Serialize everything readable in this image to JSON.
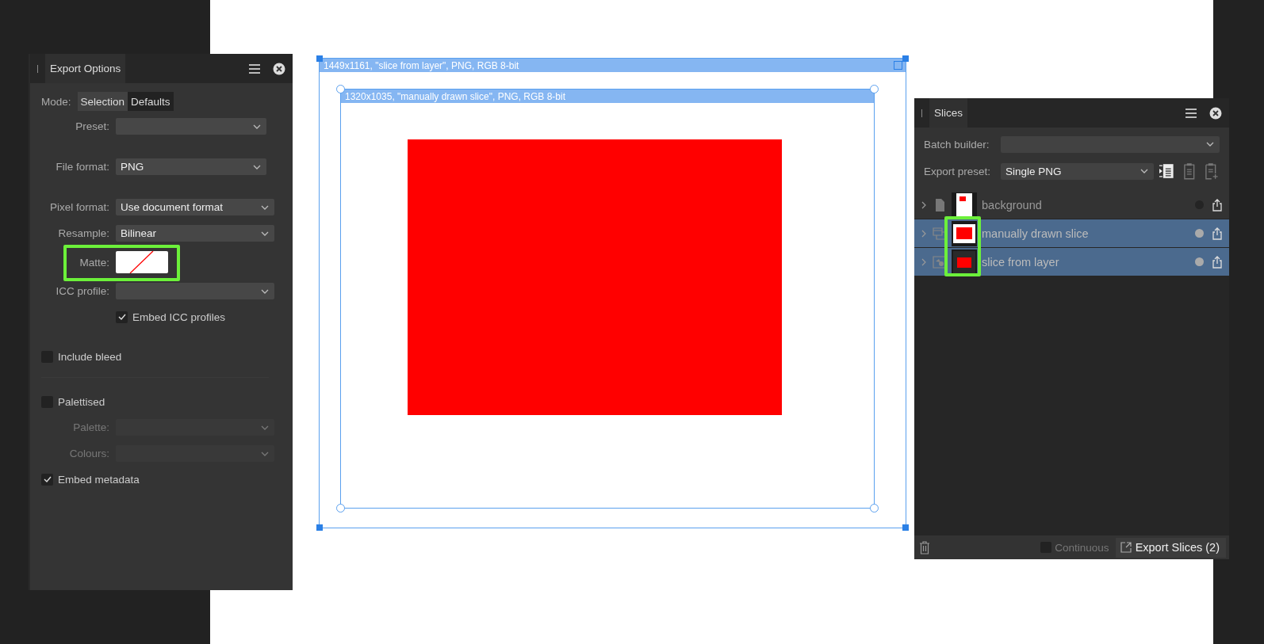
{
  "export_options": {
    "title": "Export Options",
    "mode": {
      "label": "Mode:",
      "options": [
        {
          "label": "Selection",
          "selected": false
        },
        {
          "label": "Defaults",
          "selected": true
        }
      ]
    },
    "sections": [
      [
        {
          "kind": "select",
          "label": "Preset:",
          "disabled": false
        }
      ],
      [
        {
          "kind": "select",
          "label": "File format:",
          "value": "PNG",
          "disabled": false
        }
      ],
      [
        {
          "kind": "select",
          "label": "Pixel format:",
          "value": "Use document format",
          "disabled": false
        },
        {
          "kind": "select",
          "label": "Resample:",
          "value": "Bilinear",
          "disabled": false
        },
        {
          "kind": "swatch",
          "label": "Matte:",
          "highlighted": true
        },
        {
          "kind": "select",
          "label": "ICC profile:",
          "disabled": false
        },
        {
          "kind": "field_checkbox",
          "label": "Embed ICC profiles",
          "checked": true
        }
      ],
      [
        {
          "kind": "checkbox",
          "label": "Include bleed",
          "checked": false
        }
      ],
      [
        {
          "kind": "checkbox",
          "label": "Palettised",
          "checked": false
        },
        {
          "kind": "select",
          "label": "Palette:",
          "disabled": true
        },
        {
          "kind": "select",
          "label": "Colours:",
          "disabled": true
        },
        {
          "kind": "checkbox",
          "label": "Embed metadata",
          "checked": true
        }
      ]
    ]
  },
  "canvas": {
    "slice": {
      "label": "1449x1161, \"slice from layer\", PNG, RGB 8-bit",
      "children": [
        {
          "label": "1320x1035, \"manually drawn slice\", PNG, RGB 8-bit"
        }
      ]
    }
  },
  "slices_panel": {
    "title": "Slices",
    "batch_builder": {
      "label": "Batch builder:"
    },
    "export_preset": {
      "label": "Export preset:",
      "value": "Single PNG"
    },
    "layers": [
      {
        "name": "background",
        "kind": "page",
        "selected": false,
        "expanded": false
      },
      {
        "name": "manually drawn slice",
        "kind": "manual",
        "selected": true,
        "expanded": false,
        "highlighted": true
      },
      {
        "name": "slice from layer",
        "kind": "layer",
        "selected": true,
        "expanded": false,
        "highlighted": true
      }
    ],
    "continuous": {
      "label": "Continuous",
      "checked": false
    },
    "export_button": "Export Slices (2)"
  }
}
